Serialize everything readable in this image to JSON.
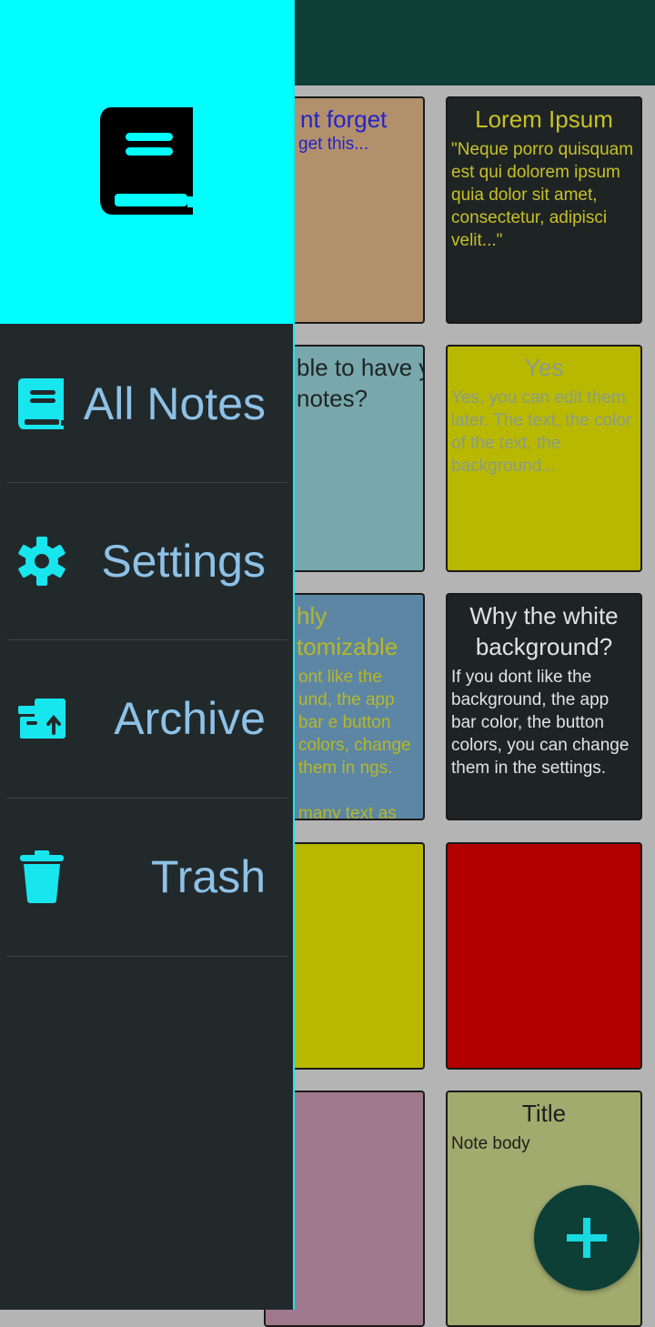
{
  "app": {
    "fab_icon": "plus-icon",
    "colors": {
      "app_bar": "#0d3f37",
      "drawer_header": "#00ffff",
      "drawer_background": "#22292b",
      "drawer_icon": "#18e6ee",
      "drawer_label": "#8ec1e6",
      "grid_background": "#b4b4b4"
    }
  },
  "drawer": {
    "logo_icon": "book-icon",
    "items": [
      {
        "label": "All Notes",
        "icon": "book-icon"
      },
      {
        "label": "Settings",
        "icon": "gear-icon"
      },
      {
        "label": "Archive",
        "icon": "archive-icon"
      },
      {
        "label": "Trash",
        "icon": "trash-icon"
      }
    ]
  },
  "notes": [
    {
      "title": "nt forget",
      "body": "get this...",
      "background": "#b3906c",
      "text_color": "#2424c8"
    },
    {
      "title": "Lorem Ipsum",
      "body": "\"Neque porro quisquam est qui dolorem ipsum quia dolor sit amet, consectetur, adipisci velit...\"",
      "background": "#1e2424",
      "text_color": "#c8c028"
    },
    {
      "title": "ble to have y notes?",
      "body": "",
      "background": "#78a8ac",
      "text_color": "#1e2424"
    },
    {
      "title": "Yes",
      "body": "Yes, you can edit them later. The text, the color of the text, the background...",
      "background": "#b8b800",
      "text_color": "#8a9c8c"
    },
    {
      "title": "hly tomizable",
      "body": "ont like the und, the app bar e button colors, change them in ngs.\n\nmany text as you note",
      "background": "#5c86a3",
      "text_color": "#b7b72a"
    },
    {
      "title": "Why the white background?",
      "body": "If you dont like the background, the app bar color, the button colors, you can change them in the settings.",
      "background": "#1e2424",
      "text_color": "#e2e2e2"
    },
    {
      "title": "",
      "body": "",
      "background": "#b8b800",
      "text_color": "#000000"
    },
    {
      "title": "",
      "body": "",
      "background": "#b20000",
      "text_color": "#000000"
    },
    {
      "title": "",
      "body": "",
      "background": "#a0788e",
      "text_color": "#000000"
    },
    {
      "title": "Title",
      "body": "Note body",
      "background": "#a2ab6e",
      "text_color": "#1e1e1e"
    }
  ]
}
